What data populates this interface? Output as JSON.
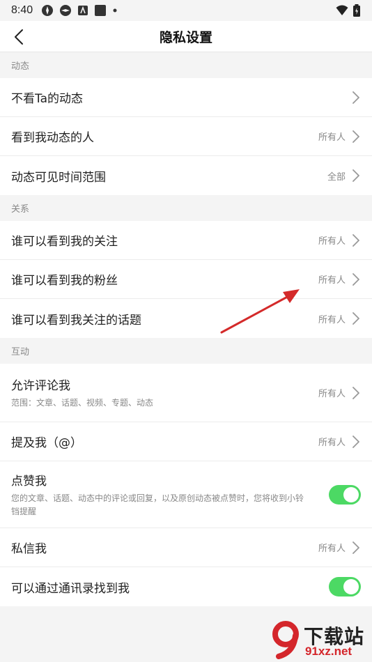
{
  "status_bar": {
    "time": "8:40"
  },
  "nav": {
    "title": "隐私设置"
  },
  "sections": {
    "dynamics": {
      "header": "动态",
      "rows": [
        {
          "label": "不看Ta的动态",
          "value": ""
        },
        {
          "label": "看到我动态的人",
          "value": "所有人"
        },
        {
          "label": "动态可见时间范围",
          "value": "全部"
        }
      ]
    },
    "relations": {
      "header": "关系",
      "rows": [
        {
          "label": "谁可以看到我的关注",
          "value": "所有人"
        },
        {
          "label": "谁可以看到我的粉丝",
          "value": "所有人"
        },
        {
          "label": "谁可以看到我关注的话题",
          "value": "所有人"
        }
      ]
    },
    "interaction": {
      "header": "互动",
      "allow_comment": {
        "label": "允许评论我",
        "sub": "范围：文章、话题、视频、专题、动态",
        "value": "所有人"
      },
      "mention": {
        "label": "提及我（@）",
        "value": "所有人"
      },
      "like": {
        "label": "点赞我",
        "sub": "您的文章、话题、动态中的评论或回复，以及原创动态被点赞时，您将收到小铃铛提醒",
        "toggle_on": true
      },
      "message": {
        "label": "私信我",
        "value": "所有人"
      },
      "contacts": {
        "label": "可以通过通讯录找到我",
        "toggle_on": true
      }
    }
  },
  "colors": {
    "toggle_on": "#4cd964",
    "annotation_arrow": "#d42a2a"
  },
  "watermark": {
    "line1": "下载站",
    "line2": "91xz.net"
  }
}
